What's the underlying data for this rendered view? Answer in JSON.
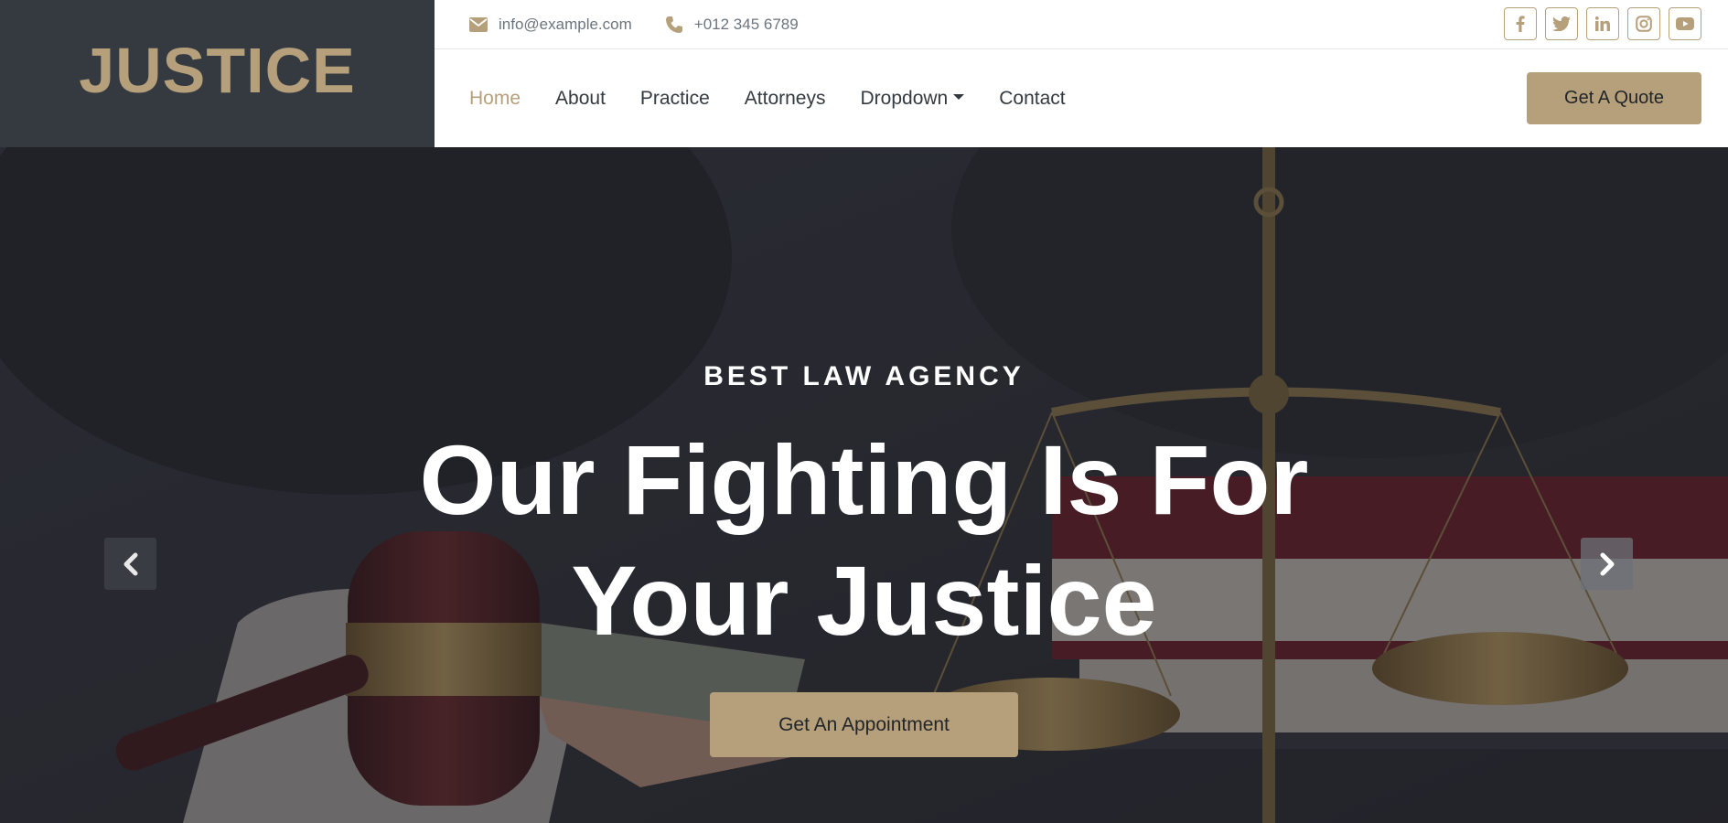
{
  "brand": {
    "name": "JUSTICE"
  },
  "topbar": {
    "email": "info@example.com",
    "phone": "+012 345 6789",
    "social": [
      "facebook-icon",
      "twitter-icon",
      "linkedin-icon",
      "instagram-icon",
      "youtube-icon"
    ]
  },
  "nav": {
    "items": [
      {
        "label": "Home",
        "active": true
      },
      {
        "label": "About"
      },
      {
        "label": "Practice"
      },
      {
        "label": "Attorneys"
      },
      {
        "label": "Dropdown",
        "dropdown": true
      },
      {
        "label": "Contact"
      }
    ],
    "cta": "Get A Quote"
  },
  "hero": {
    "subtitle": "BEST LAW AGENCY",
    "title": "Our Fighting Is For Your Justice",
    "button": "Get An Appointment"
  },
  "colors": {
    "accent": "#b6a07c",
    "brand_bg": "#343a40",
    "text_dark": "#333a40"
  }
}
